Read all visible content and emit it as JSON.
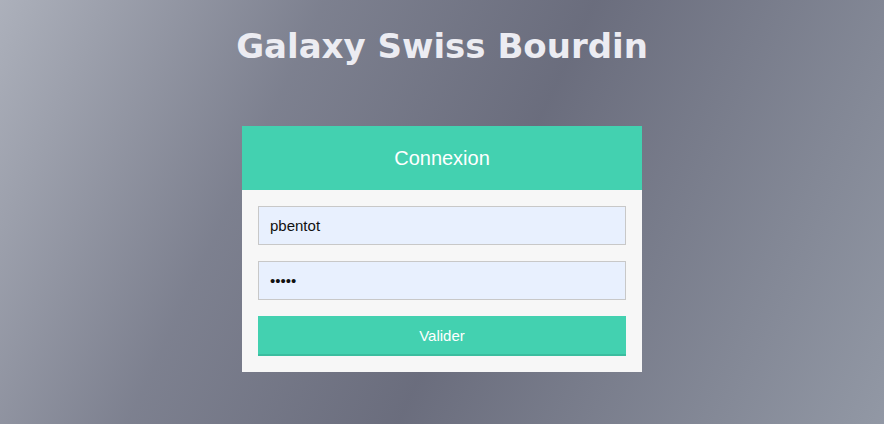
{
  "page": {
    "title": "Galaxy Swiss Bourdin"
  },
  "login_form": {
    "header": "Connexion",
    "fields": [
      {
        "name": "login",
        "value": "pbentot"
      },
      {
        "name": "password",
        "value": "•••••"
      }
    ],
    "submit": "Valider"
  }
}
